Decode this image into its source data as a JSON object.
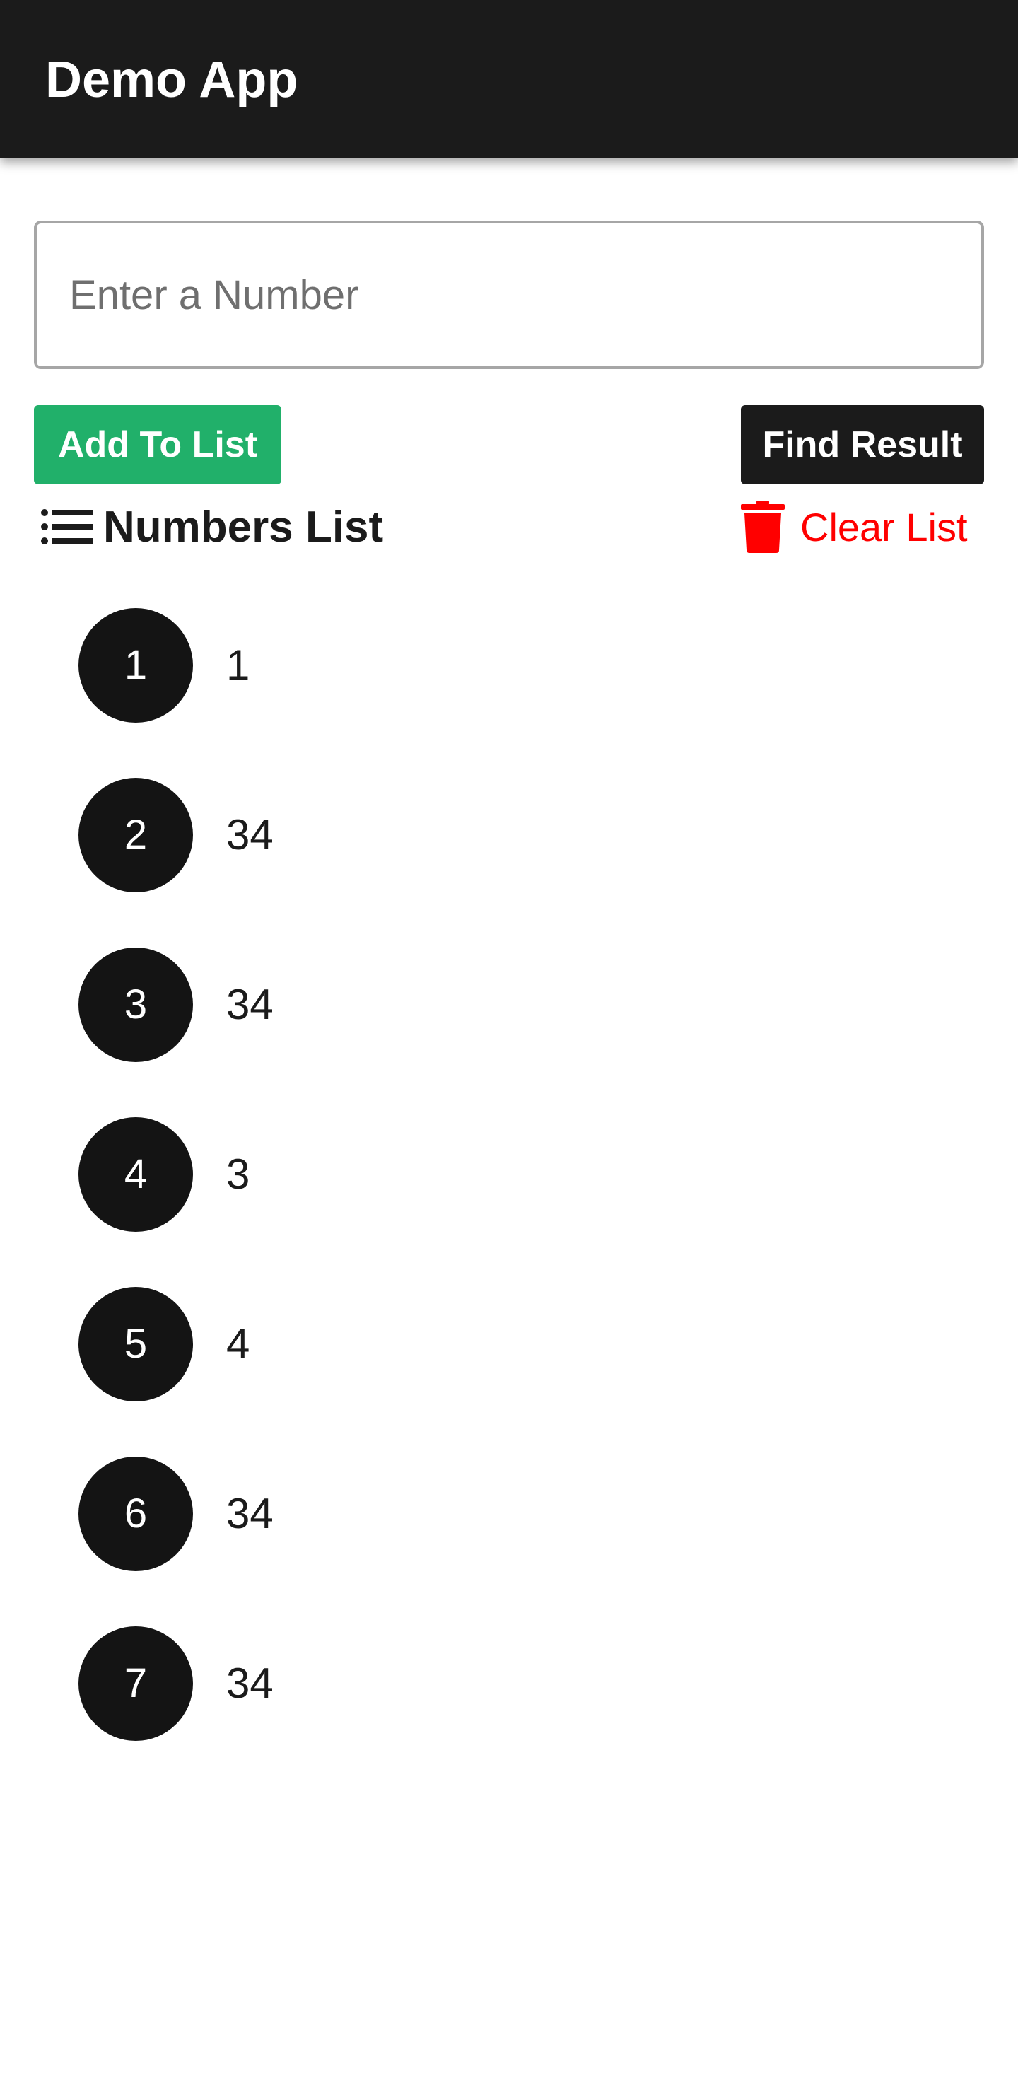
{
  "app_bar": {
    "title": "Demo App"
  },
  "form": {
    "input_placeholder": "Enter a Number",
    "input_value": "",
    "add_button_label": "Add To List",
    "find_button_label": "Find Result"
  },
  "list_section": {
    "title": "Numbers List",
    "title_icon": "list-icon",
    "clear_label": "Clear List",
    "clear_icon": "trash-icon",
    "items": [
      {
        "index": "1",
        "value": "1"
      },
      {
        "index": "2",
        "value": "34"
      },
      {
        "index": "3",
        "value": "34"
      },
      {
        "index": "4",
        "value": "3"
      },
      {
        "index": "5",
        "value": "4"
      },
      {
        "index": "6",
        "value": "34"
      },
      {
        "index": "7",
        "value": "34"
      }
    ]
  },
  "colors": {
    "app_bar": "#1b1b1b",
    "add_button": "#21b06a",
    "find_button": "#1b1b1b",
    "clear_accent": "#ff0000",
    "badge": "#141414"
  }
}
